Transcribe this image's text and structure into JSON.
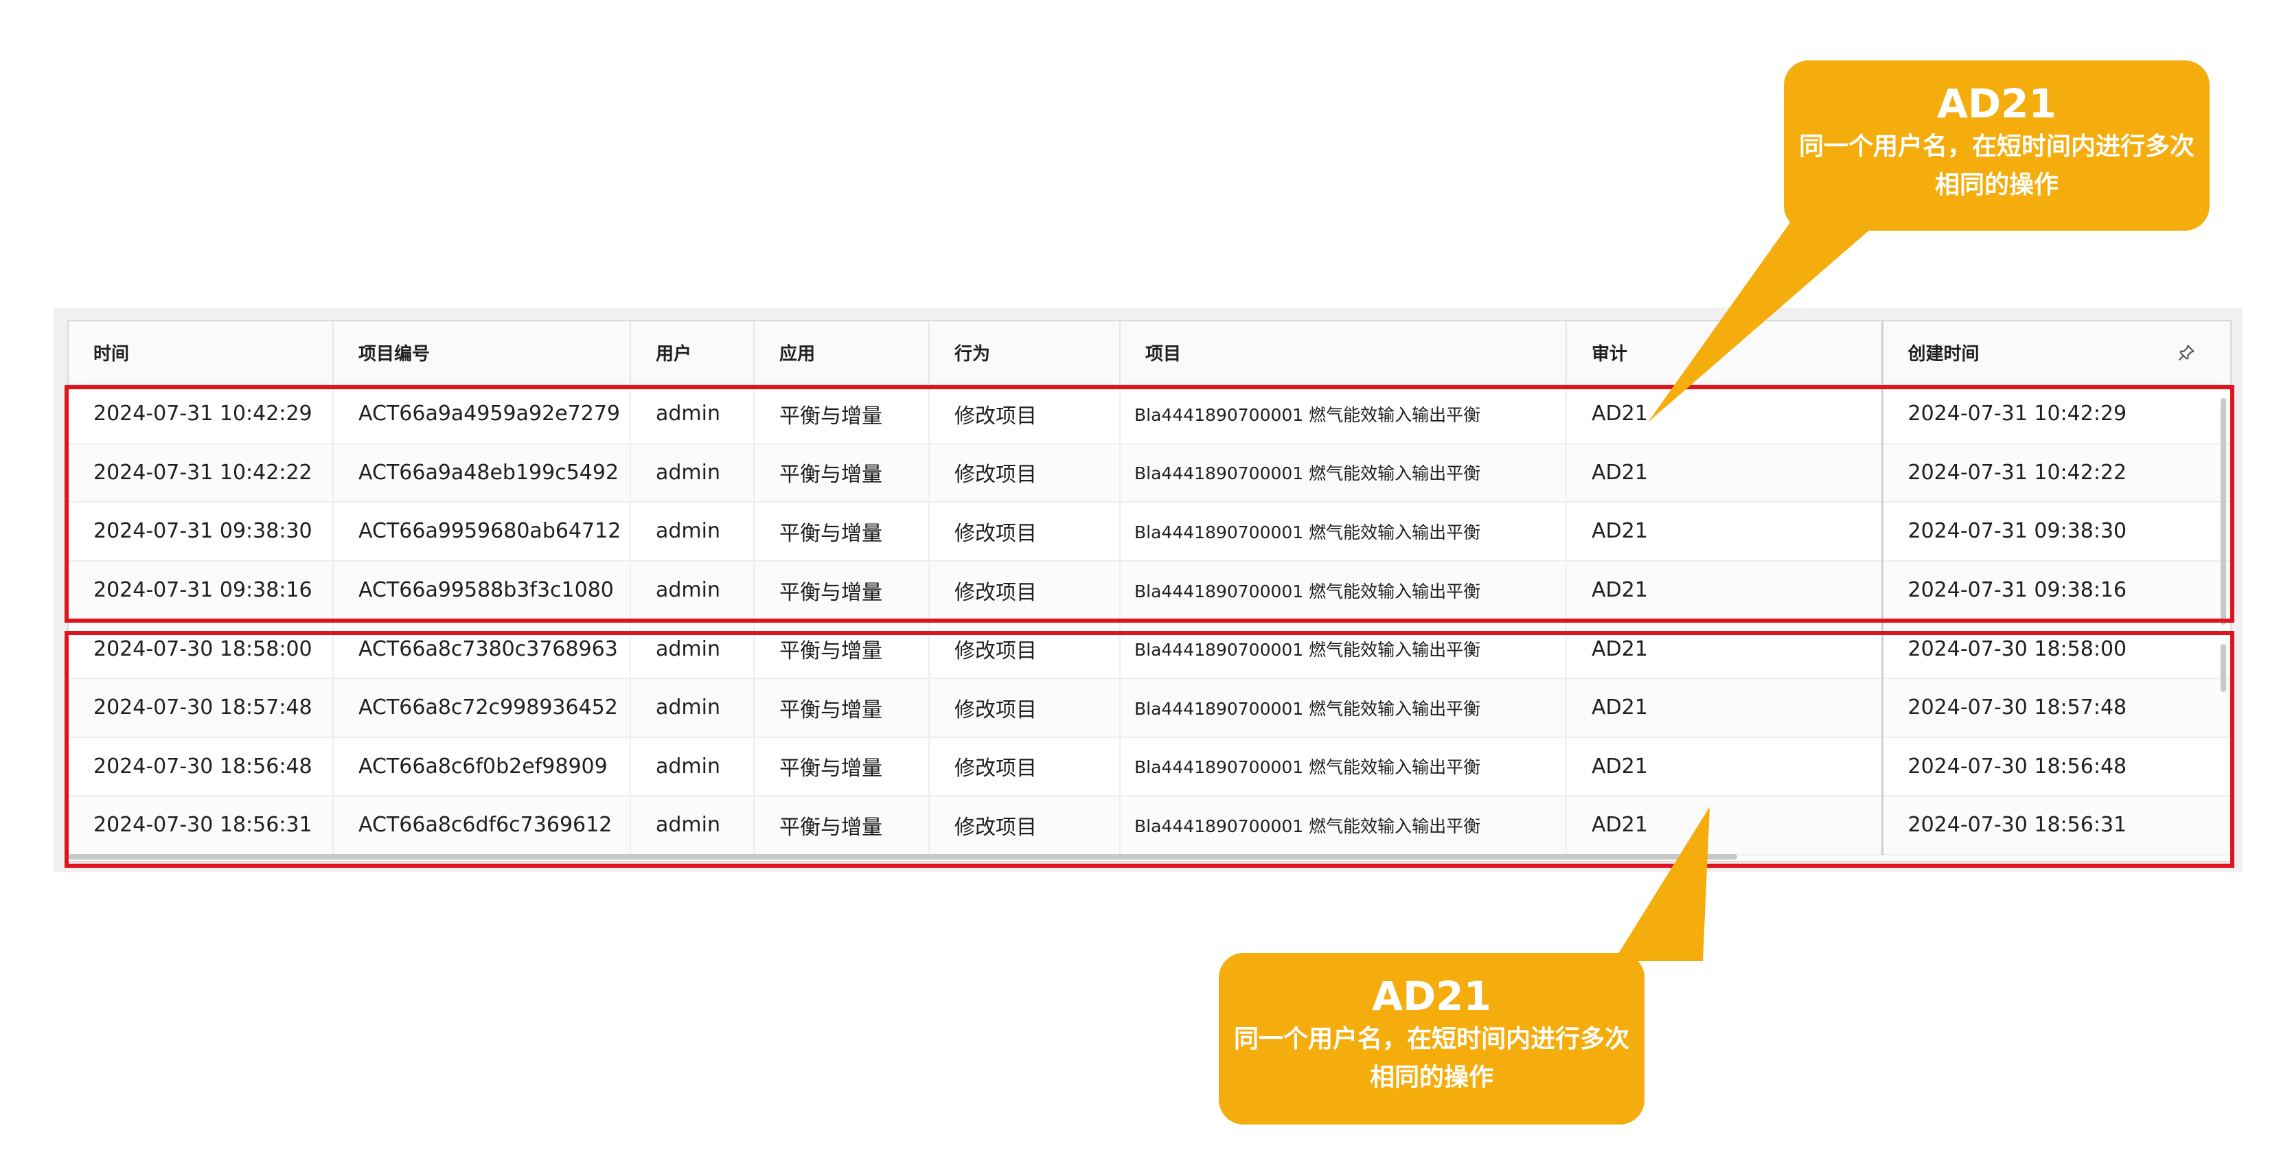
{
  "table": {
    "columns": [
      "时间",
      "项目编号",
      "用户",
      "应用",
      "行为",
      "项目",
      "审计",
      "创建时间"
    ],
    "rows": [
      [
        "2024-07-31 10:42:29",
        "ACT66a9a4959a92e7279",
        "admin",
        "平衡与增量",
        "修改项目",
        "Bla4441890700001 燃气能效输入输出平衡",
        "AD21",
        "2024-07-31 10:42:29"
      ],
      [
        "2024-07-31 10:42:22",
        "ACT66a9a48eb199c5492",
        "admin",
        "平衡与增量",
        "修改项目",
        "Bla4441890700001 燃气能效输入输出平衡",
        "AD21",
        "2024-07-31 10:42:22"
      ],
      [
        "2024-07-31 09:38:30",
        "ACT66a9959680ab64712",
        "admin",
        "平衡与增量",
        "修改项目",
        "Bla4441890700001 燃气能效输入输出平衡",
        "AD21",
        "2024-07-31 09:38:30"
      ],
      [
        "2024-07-31 09:38:16",
        "ACT66a99588b3f3c1080",
        "admin",
        "平衡与增量",
        "修改项目",
        "Bla4441890700001 燃气能效输入输出平衡",
        "AD21",
        "2024-07-31 09:38:16"
      ],
      [
        "2024-07-30 18:58:00",
        "ACT66a8c7380c3768963",
        "admin",
        "平衡与增量",
        "修改项目",
        "Bla4441890700001 燃气能效输入输出平衡",
        "AD21",
        "2024-07-30 18:58:00"
      ],
      [
        "2024-07-30 18:57:48",
        "ACT66a8c72c998936452",
        "admin",
        "平衡与增量",
        "修改项目",
        "Bla4441890700001 燃气能效输入输出平衡",
        "AD21",
        "2024-07-30 18:57:48"
      ],
      [
        "2024-07-30 18:56:48",
        "ACT66a8c6f0b2ef98909",
        "admin",
        "平衡与增量",
        "修改项目",
        "Bla4441890700001 燃气能效输入输出平衡",
        "AD21",
        "2024-07-30 18:56:48"
      ],
      [
        "2024-07-30 18:56:31",
        "ACT66a8c6df6c7369612",
        "admin",
        "平衡与增量",
        "修改项目",
        "Bla4441890700001 燃气能效输入输出平衡",
        "AD21",
        "2024-07-30 18:56:31"
      ]
    ],
    "pin_icon": "pin-icon"
  },
  "callouts": [
    {
      "title": "AD21",
      "text": "同一个用户名，在短时间内进行多次相同的操作"
    },
    {
      "title": "AD21",
      "text": "同一个用户名，在短时间内进行多次相同的操作"
    }
  ],
  "colors": {
    "highlight": "#e0141e",
    "callout": "#f5ad0d"
  }
}
